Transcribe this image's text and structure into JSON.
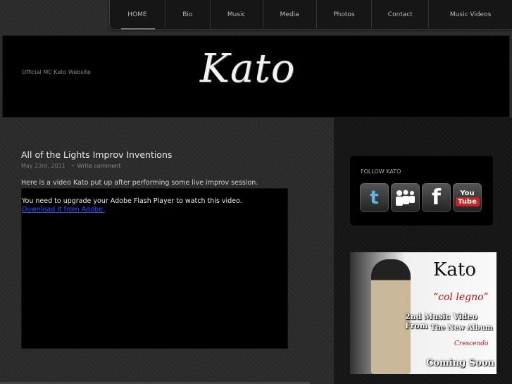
{
  "nav": {
    "items": [
      {
        "label": "HOME"
      },
      {
        "label": "Bio"
      },
      {
        "label": "Music"
      },
      {
        "label": "Media"
      },
      {
        "label": "Photos"
      },
      {
        "label": "Contact"
      },
      {
        "label": "Music Videos"
      }
    ]
  },
  "header": {
    "tagline": "Official MC Kato Website",
    "logo": "Kato"
  },
  "post": {
    "title": "All of the Lights Improv Inventions",
    "date": "May 23rd, 2011",
    "separator": "•",
    "comment_link": "Write comment",
    "body": "Here is a video Kato put up after performing some live improv session.",
    "flash_message": "You need to upgrade your Adobe Flash Player to watch this video.",
    "flash_link": "Download it from Adobe."
  },
  "sidebar": {
    "follow_title": "FOLLOW KATO",
    "social": [
      {
        "icon": "twitter-icon",
        "glyph": "t"
      },
      {
        "icon": "myspace-icon",
        "glyph": "♟♟"
      },
      {
        "icon": "facebook-icon",
        "glyph": "f"
      },
      {
        "icon": "youtube-icon",
        "line1": "You",
        "line2": "Tube"
      }
    ],
    "promo": {
      "name": "Kato",
      "subtitle": "“col legno”",
      "line1": "2nd Music Video From",
      "line2": "The New Album",
      "line3": "Crescendo",
      "line4": "Coming Soon"
    }
  }
}
